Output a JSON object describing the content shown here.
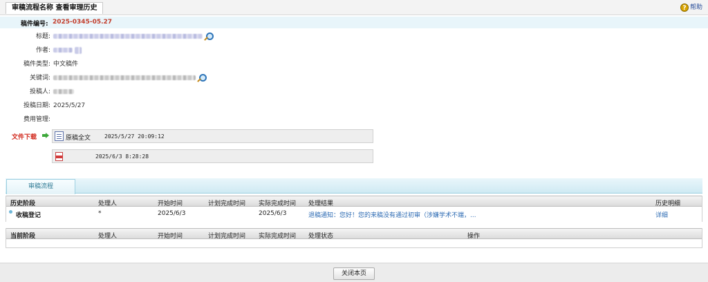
{
  "header": {
    "title": "审稿流程名称 查看审理历史",
    "help_label": "帮助"
  },
  "manuscript": {
    "number_label": "稿件编号:",
    "number_value": "2025-0345-05.27"
  },
  "fields": {
    "title_label": "标题:",
    "author_label": "作者:",
    "type_label": "稿件类型:",
    "type_value": "中文稿件",
    "keywords_label": "关键词:",
    "submitter_label": "投稿人:",
    "date_label": "投稿日期:",
    "date_value": "2025/5/27",
    "fee_label": "费用管理:"
  },
  "downloads": {
    "label": "文件下载",
    "files": [
      {
        "icon": "doc-icon",
        "name": "原稿全文",
        "time": "2025/5/27 20:09:12"
      },
      {
        "icon": "pdf-icon",
        "name": "",
        "time": "2025/6/3 8:28:28"
      }
    ]
  },
  "workflow": {
    "tab_label": "审稿流程",
    "history_headers": [
      "历史阶段",
      "处理人",
      "开始时间",
      "计划完成时间",
      "实际完成时间",
      "处理结果",
      "历史明细"
    ],
    "history_rows": [
      {
        "stage": "收稿登记",
        "handler": "*",
        "start": "2025/6/3",
        "planned": "",
        "actual": "2025/6/3",
        "result": "退稿通知：您好！您的来稿没有通过初审（涉嫌学术不端，...",
        "detail": "详细"
      }
    ],
    "current_headers": [
      "当前阶段",
      "处理人",
      "开始时间",
      "计划完成时间",
      "实际完成时间",
      "处理状态",
      "操作"
    ]
  },
  "footer": {
    "close_label": "关闭本页"
  },
  "colors": {
    "accent_red": "#c23d2b",
    "link_blue": "#2d6bb3",
    "tab_teal": "#2f7a94"
  }
}
